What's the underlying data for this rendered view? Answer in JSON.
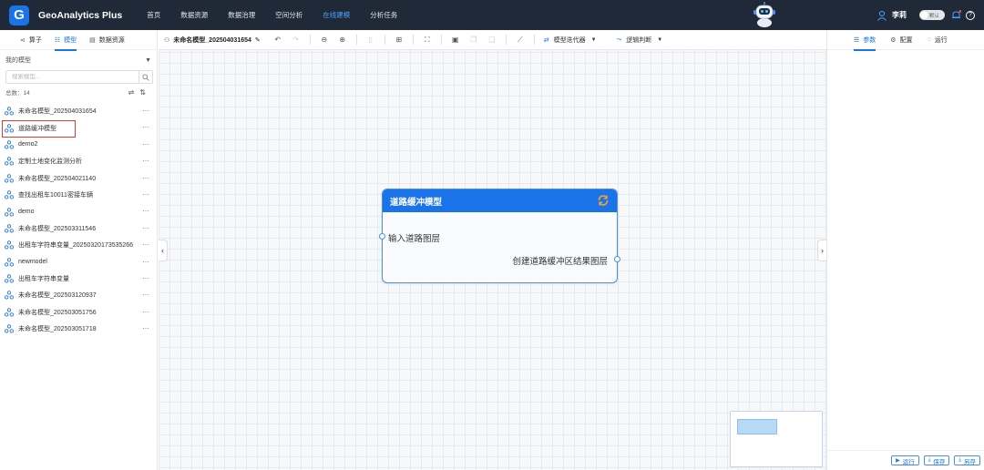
{
  "header": {
    "logo_letter": "G",
    "app_title": "GeoAnalytics Plus",
    "nav": [
      {
        "label": "首页"
      },
      {
        "label": "数据资源"
      },
      {
        "label": "数据治理"
      },
      {
        "label": "空间分析"
      },
      {
        "label": "在线建模"
      },
      {
        "label": "分析任务"
      }
    ],
    "active_nav": "在线建模",
    "user_name": "李莉",
    "toggle_label": "默认",
    "help_icon": "?"
  },
  "left_panel": {
    "tabs": [
      {
        "label": "算子",
        "icon": "share-icon"
      },
      {
        "label": "模型",
        "icon": "grid-icon"
      },
      {
        "label": "数据资源",
        "icon": "table-icon"
      }
    ],
    "active_tab": "模型",
    "section_title": "我的模型",
    "search_placeholder": "搜索模型...",
    "total_label": "总数：14",
    "models": [
      {
        "label": "未命名模型_202504031654"
      },
      {
        "label": "道路缓冲模型",
        "selected": true
      },
      {
        "label": "demo2"
      },
      {
        "label": "定制土地变化监测分析"
      },
      {
        "label": "未命名模型_202504021140"
      },
      {
        "label": "查找出租车10011密接车辆"
      },
      {
        "label": "demo"
      },
      {
        "label": "未命名模型_202503311546"
      },
      {
        "label": "出租车字符串变量_20250320173535266"
      },
      {
        "label": "newmodel"
      },
      {
        "label": "出租车字符串变量"
      },
      {
        "label": "未命名模型_202503120937"
      },
      {
        "label": "未命名模型_202503051756"
      },
      {
        "label": "未命名模型_202503051718"
      }
    ],
    "more_label": "···"
  },
  "toolbar": {
    "title": "未命名模型_202504031654",
    "iterator_label": "模型迭代器",
    "logic_label": "逻辑判断"
  },
  "canvas": {
    "node": {
      "title": "道路缓冲模型",
      "input_port": "输入道路图层",
      "output_port": "创建道路缓冲区结果图层"
    },
    "collapse_left": "‹",
    "collapse_right": "›"
  },
  "right_panel": {
    "tabs": [
      {
        "label": "参数",
        "icon": "params-icon"
      },
      {
        "label": "配置",
        "icon": "gear-icon"
      },
      {
        "label": "运行",
        "icon": "chat-icon"
      }
    ],
    "active_tab": "参数",
    "footer_buttons": [
      {
        "label": "运行",
        "icon": "play-icon"
      },
      {
        "label": "保存",
        "icon": "download-icon"
      },
      {
        "label": "另存",
        "icon": "download-icon"
      }
    ]
  },
  "colors": {
    "topbar_bg": "#1f2937",
    "accent": "#1a73e8",
    "active_nav": "#4aa3ff",
    "selection_border": "#e53935",
    "node_ref_icon": "#f5a623"
  }
}
